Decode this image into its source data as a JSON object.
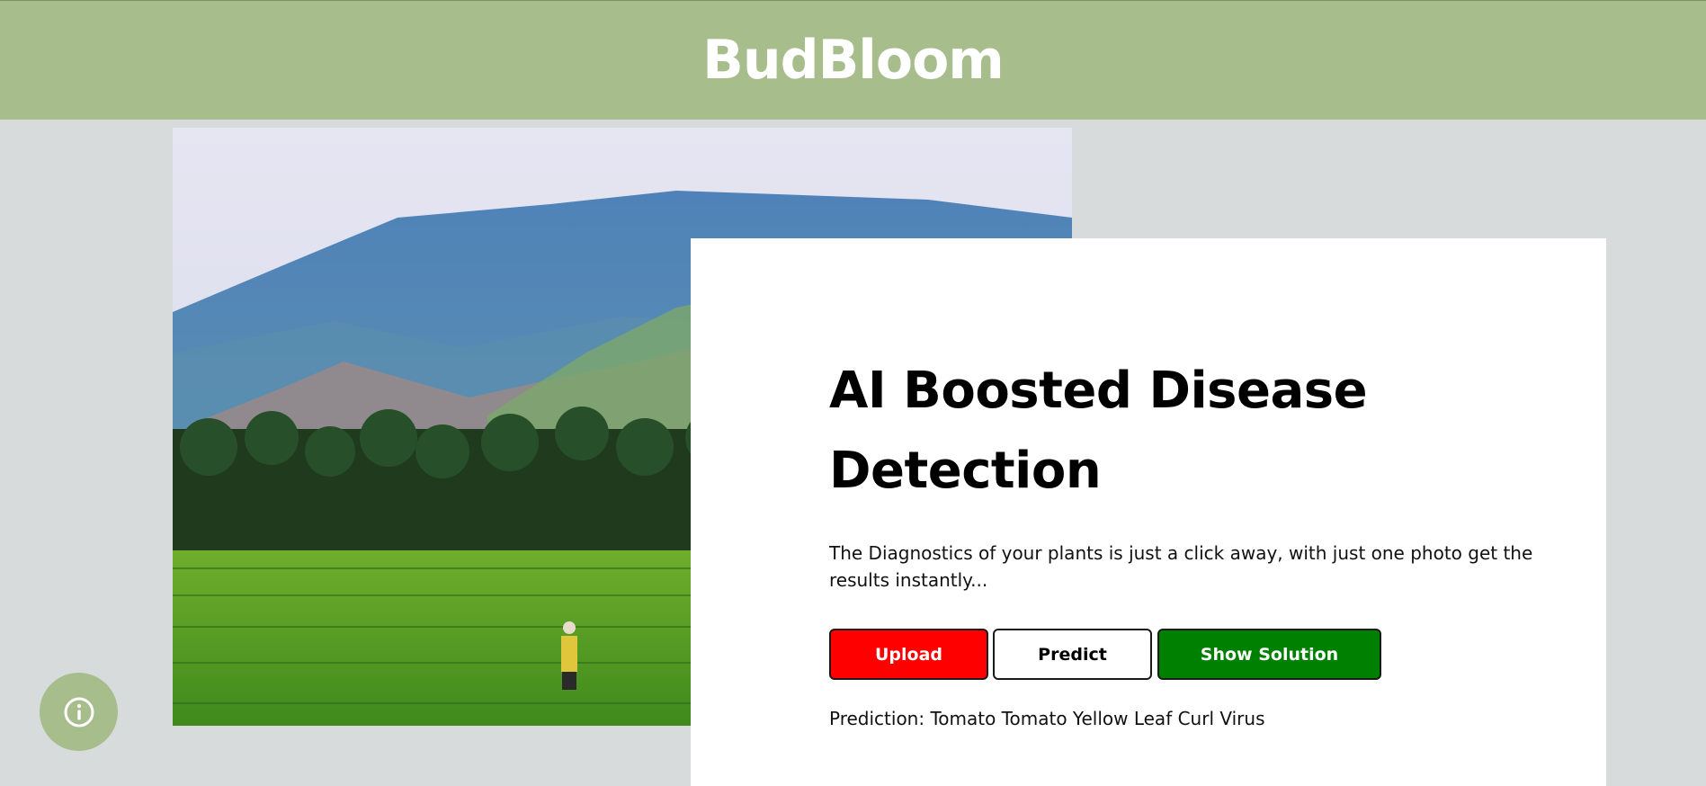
{
  "header": {
    "brand": "BudBloom",
    "background_color": "#a7bd8c"
  },
  "hero": {
    "image_description_icon": "landscape-photo"
  },
  "card": {
    "title": "AI Boosted Disease Detection",
    "description": "The Diagnostics of your plants is just a click away, with just one photo get the results instantly...",
    "buttons": {
      "upload": "Upload",
      "predict": "Predict",
      "show_solution": "Show Solution"
    },
    "prediction": "Prediction: Tomato Tomato Yellow Leaf Curl Virus"
  },
  "colors": {
    "upload_button": "#ff0000",
    "predict_button": "#ffffff",
    "solution_button": "#008000",
    "page_background": "#d8dbdb"
  },
  "info_button": {
    "icon": "info-icon"
  }
}
